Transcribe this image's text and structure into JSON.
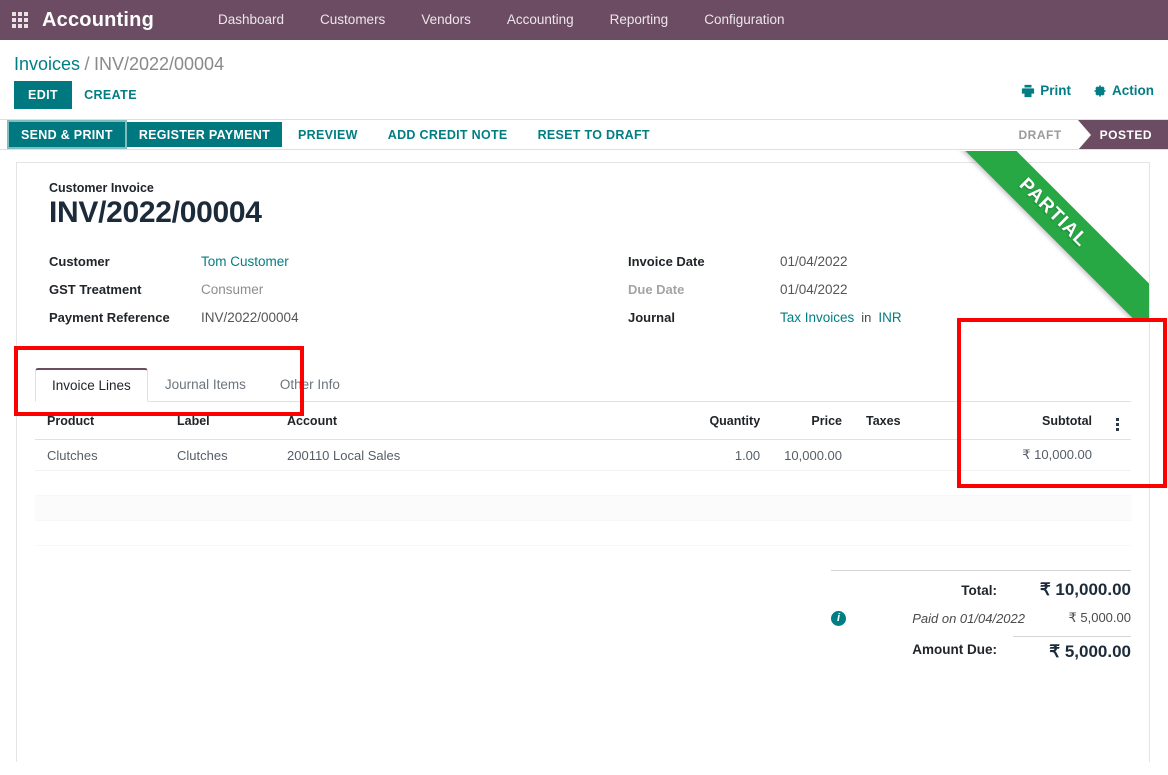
{
  "navbar": {
    "apps_icon": "apps-grid-icon",
    "brand": "Accounting",
    "links": [
      {
        "label": "Dashboard"
      },
      {
        "label": "Customers"
      },
      {
        "label": "Vendors"
      },
      {
        "label": "Accounting"
      },
      {
        "label": "Reporting"
      },
      {
        "label": "Configuration"
      }
    ]
  },
  "breadcrumb": {
    "root": "Invoices",
    "separator": "/",
    "current": "INV/2022/00004"
  },
  "control_panel": {
    "edit_label": "EDIT",
    "create_label": "CREATE",
    "print_label": "Print",
    "print_icon": "printer-icon",
    "action_label": "Action",
    "action_icon": "gear-icon"
  },
  "statusbar": {
    "buttons": [
      {
        "label": "SEND & PRINT",
        "style": "primary-focused"
      },
      {
        "label": "REGISTER PAYMENT",
        "style": "primary"
      },
      {
        "label": "PREVIEW",
        "style": "link"
      },
      {
        "label": "ADD CREDIT NOTE",
        "style": "link"
      },
      {
        "label": "RESET TO DRAFT",
        "style": "link"
      }
    ],
    "states": [
      {
        "label": "DRAFT",
        "active": false
      },
      {
        "label": "POSTED",
        "active": true
      }
    ]
  },
  "ribbon": {
    "label": "PARTIAL",
    "color": "#28a745"
  },
  "title": {
    "label": "Customer Invoice",
    "value": "INV/2022/00004"
  },
  "fields_left": [
    {
      "label": "Customer",
      "value": "Tom Customer",
      "style": "link"
    },
    {
      "label": "GST Treatment",
      "value": "Consumer",
      "style": "grey"
    },
    {
      "label": "Payment Reference",
      "value": "INV/2022/00004",
      "style": "dark"
    }
  ],
  "fields_right": [
    {
      "label": "Invoice Date",
      "value": "01/04/2022",
      "style": "dark",
      "label_muted": false
    },
    {
      "label": "Due Date",
      "value": "01/04/2022",
      "style": "dark",
      "label_muted": true
    },
    {
      "label": "Journal",
      "value": "Tax Invoices",
      "style": "link",
      "label_muted": false,
      "separator": "in",
      "value2": "INR"
    }
  ],
  "tabs": [
    {
      "label": "Invoice Lines",
      "active": true
    },
    {
      "label": "Journal Items",
      "active": false
    },
    {
      "label": "Other Info",
      "active": false
    }
  ],
  "table": {
    "headers": [
      "Product",
      "Label",
      "Account",
      "Quantity",
      "Price",
      "Taxes",
      "Subtotal"
    ],
    "optional_columns_icon": "vertical-ellipsis-icon",
    "rows": [
      {
        "product": "Clutches",
        "label": "Clutches",
        "account": "200110 Local Sales",
        "quantity": "1.00",
        "price": "10,000.00",
        "taxes": "",
        "subtotal": "₹ 10,000.00"
      }
    ]
  },
  "totals": {
    "total_label": "Total:",
    "total_value": "₹ 10,000.00",
    "info_icon": "info-circle-icon",
    "paid_label": "Paid on 01/04/2022",
    "paid_value": "₹ 5,000.00",
    "due_label": "Amount Due:",
    "due_value": "₹ 5,000.00"
  },
  "annotations": [
    {
      "name": "highlight-invoice-title",
      "color": "#ff0000"
    },
    {
      "name": "highlight-partial-ribbon",
      "color": "#ff0000"
    }
  ]
}
